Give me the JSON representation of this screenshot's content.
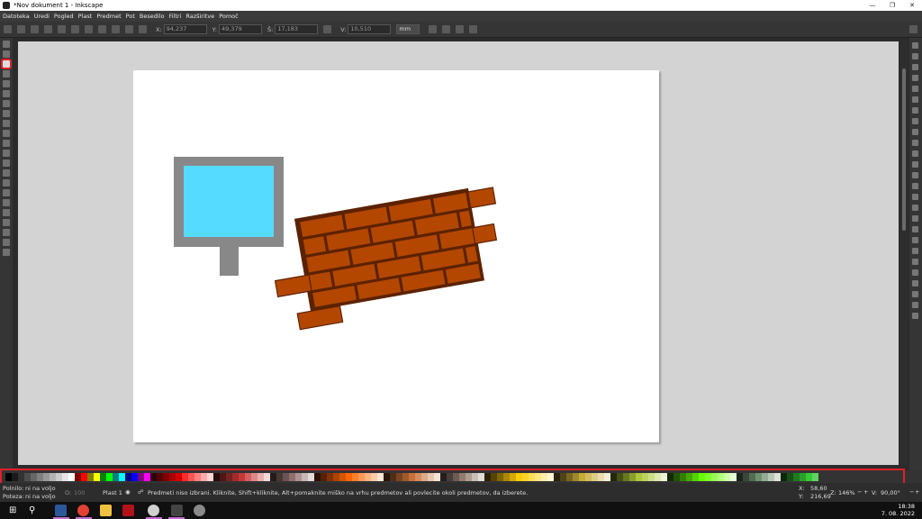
{
  "window": {
    "title": "*Nov dokument 1 - Inkscape"
  },
  "menu": [
    "Datoteka",
    "Uredi",
    "Pogled",
    "Plast",
    "Predmet",
    "Pot",
    "Besedilo",
    "Filtri",
    "Razširitve",
    "Pomoč"
  ],
  "toolbar": {
    "x_label": "X:",
    "x_value": "94,237",
    "y_label": "Y:",
    "y_value": "49,379",
    "w_label": "Š:",
    "w_value": "17,183",
    "h_label": "V:",
    "h_value": "10,510",
    "unit": "mm"
  },
  "status": {
    "fill_label": "Polnilo:",
    "fill_value": "ni na voljo",
    "stroke_label": "Poteza:",
    "stroke_value": "ni na voljo",
    "opacity_label": "O:",
    "opacity_value": "100",
    "layer": "Plast 1",
    "message": "Predmeti niso izbrani. Kliknite, Shift+kliknite, Alt+pomaknite miško na vrhu predmetov ali povlecite okoli predmetov, da izberete.",
    "x_label": "X:",
    "x_value": "58,60",
    "y_label": "Y:",
    "y_value": "216,69",
    "zoom_label": "Z:",
    "zoom_value": "146%",
    "rot_label": "V:",
    "rot_value": "90,00°"
  },
  "clock": {
    "time": "18:38",
    "date": "7. 08. 2022"
  },
  "colors": {
    "accent": "#e0202a",
    "screen_fill": "#55dbff",
    "monitor_gray": "#888888",
    "brick": "#b34700",
    "mortar": "#5c2200"
  }
}
